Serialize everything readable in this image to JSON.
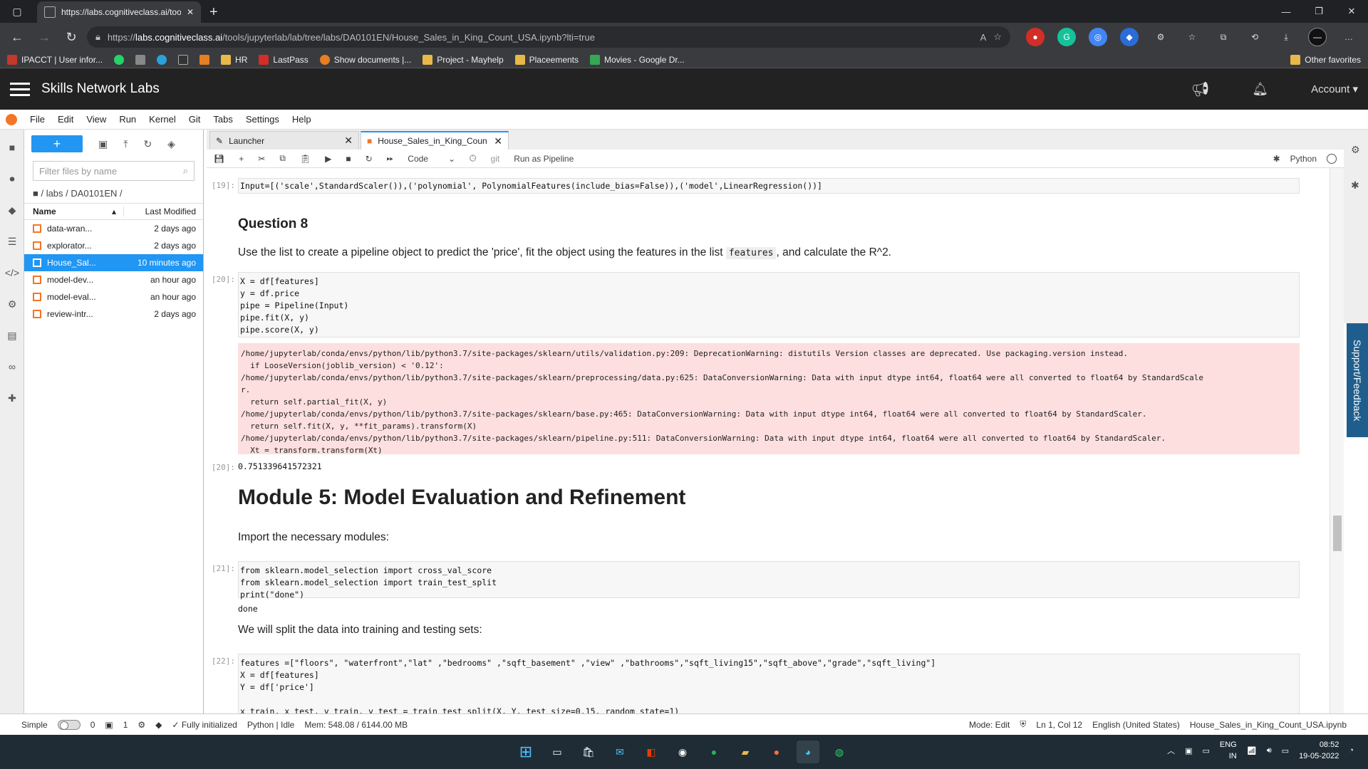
{
  "browser": {
    "tab_title": "https://labs.cognitiveclass.ai/too",
    "url_prefix": "https://",
    "url_host": "labs.cognitiveclass.ai",
    "url_path": "/tools/jupyterlab/lab/tree/labs/DA0101EN/House_Sales_in_King_Count_USA.ipynb?lti=true"
  },
  "bookmarks": [
    {
      "label": "IPACCT | User infor...",
      "color": "#c0392b"
    },
    {
      "label": "",
      "color": "#25d366"
    },
    {
      "label": "",
      "color": "#888"
    },
    {
      "label": "",
      "color": "#2aa1da"
    },
    {
      "label": "",
      "color": "#333"
    },
    {
      "label": "",
      "color": "#e67e22"
    },
    {
      "label": "HR",
      "color": "#e8b949"
    },
    {
      "label": "LastPass",
      "color": "#d32d27"
    },
    {
      "label": "Show documents |...",
      "color": "#e67e22"
    },
    {
      "label": "Project - Mayhelp",
      "color": "#e8b949"
    },
    {
      "label": "Placeements",
      "color": "#e8b949"
    },
    {
      "label": "Movies - Google Dr...",
      "color": "#34a853"
    }
  ],
  "bookmarks_other": "Other favorites",
  "snl": {
    "title": "Skills Network Labs",
    "account": "Account"
  },
  "menu": [
    "File",
    "Edit",
    "View",
    "Run",
    "Kernel",
    "Git",
    "Tabs",
    "Settings",
    "Help"
  ],
  "filebrowser": {
    "filter_placeholder": "Filter files by name",
    "crumb": "/ labs / DA0101EN /",
    "col_name": "Name",
    "col_modified": "Last Modified",
    "files": [
      {
        "name": "data-wran...",
        "modified": "2 days ago"
      },
      {
        "name": "explorator...",
        "modified": "2 days ago"
      },
      {
        "name": "House_Sal...",
        "modified": "10 minutes ago"
      },
      {
        "name": "model-dev...",
        "modified": "an hour ago"
      },
      {
        "name": "model-eval...",
        "modified": "an hour ago"
      },
      {
        "name": "review-intr...",
        "modified": "2 days ago"
      }
    ]
  },
  "doc_tabs": [
    {
      "label": "Launcher"
    },
    {
      "label": "House_Sales_in_King_Coun"
    }
  ],
  "nb_toolbar": {
    "cell_type": "Code",
    "git": "git",
    "pipeline": "Run as Pipeline",
    "kernel": "Python"
  },
  "cells": {
    "c19_prompt": "[19]:",
    "c19_code": "Input=[('scale',StandardScaler()),('polynomial', PolynomialFeatures(include_bias=False)),('model',LinearRegression())]",
    "q8_title": "Question 8",
    "q8_text_a": "Use the list to create a pipeline object to predict the 'price', fit the object using the features in the list",
    "q8_inline": "features",
    "q8_text_b": ", and calculate the R^2.",
    "c20_prompt": "[20]:",
    "c20_code": "X = df[features]\ny = df.price\npipe = Pipeline(Input)\npipe.fit(X, y)\npipe.score(X, y)",
    "c20_err": "/home/jupyterlab/conda/envs/python/lib/python3.7/site-packages/sklearn/utils/validation.py:209: DeprecationWarning: distutils Version classes are deprecated. Use packaging.version instead.\n  if LooseVersion(joblib_version) < '0.12':\n/home/jupyterlab/conda/envs/python/lib/python3.7/site-packages/sklearn/preprocessing/data.py:625: DataConversionWarning: Data with input dtype int64, float64 were all converted to float64 by StandardScale\nr.\n  return self.partial_fit(X, y)\n/home/jupyterlab/conda/envs/python/lib/python3.7/site-packages/sklearn/base.py:465: DataConversionWarning: Data with input dtype int64, float64 were all converted to float64 by StandardScaler.\n  return self.fit(X, y, **fit_params).transform(X)\n/home/jupyterlab/conda/envs/python/lib/python3.7/site-packages/sklearn/pipeline.py:511: DataConversionWarning: Data with input dtype int64, float64 were all converted to float64 by StandardScaler.\n  Xt = transform.transform(Xt)",
    "c20_out_prompt": "[20]:",
    "c20_out": "0.751339641572321",
    "m5_title": "Module 5: Model Evaluation and Refinement",
    "m5_text": "Import the necessary modules:",
    "c21_prompt": "[21]:",
    "c21_code": "from sklearn.model_selection import cross_val_score\nfrom sklearn.model_selection import train_test_split\nprint(\"done\")",
    "c21_out": "done",
    "split_text": "We will split the data into training and testing sets:",
    "c22_prompt": "[22]:",
    "c22_code": "features =[\"floors\", \"waterfront\",\"lat\" ,\"bedrooms\" ,\"sqft_basement\" ,\"view\" ,\"bathrooms\",\"sqft_living15\",\"sqft_above\",\"grade\",\"sqft_living\"]\nX = df[features]\nY = df['price']\n\nx_train, x_test, y_train, y_test = train_test_split(X, Y, test_size=0.15, random_state=1)"
  },
  "support": "Support/Feedback",
  "status": {
    "mode_simple": "Simple",
    "zero": "0",
    "one": "1",
    "init": "Fully initialized",
    "kernel": "Python | Idle",
    "mem": "Mem: 548.08 / 6144.00 MB",
    "mode": "Mode: Edit",
    "pos": "Ln 1, Col 12",
    "lang": "English (United States)",
    "file": "House_Sales_in_King_Count_USA.ipynb"
  },
  "taskbar": {
    "lang1": "ENG",
    "lang2": "IN",
    "time": "08:52",
    "date": "19-05-2022"
  }
}
